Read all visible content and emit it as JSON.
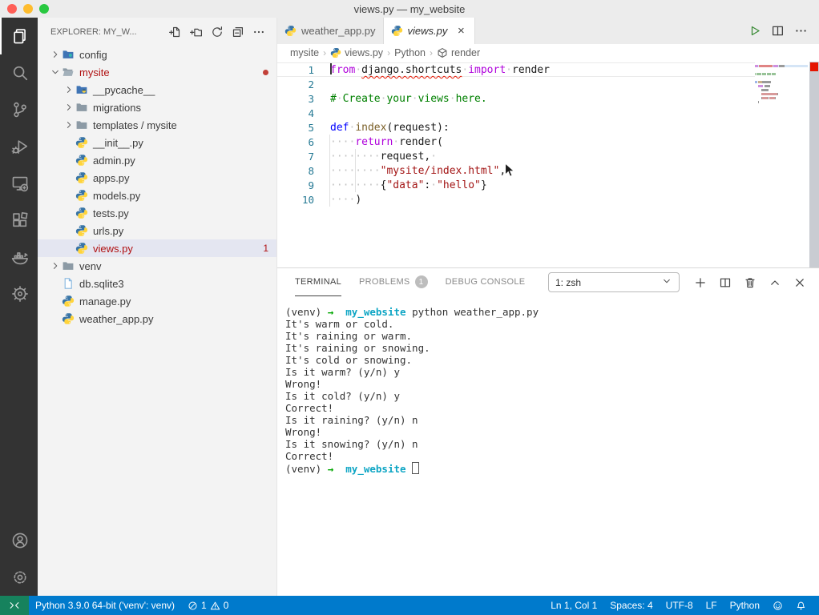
{
  "window": {
    "title": "views.py — my_website"
  },
  "activity_bar": {
    "top": [
      {
        "name": "explorer",
        "icon": "files",
        "active": true
      },
      {
        "name": "search",
        "icon": "search",
        "active": false
      },
      {
        "name": "source-control",
        "icon": "source-control",
        "active": false
      },
      {
        "name": "run-debug",
        "icon": "run-debug",
        "active": false
      },
      {
        "name": "remote-explorer",
        "icon": "remote-explorer",
        "active": false
      },
      {
        "name": "extensions",
        "icon": "extensions",
        "active": false
      },
      {
        "name": "docker",
        "icon": "docker",
        "active": false
      },
      {
        "name": "wheel",
        "icon": "wheel",
        "active": false
      }
    ],
    "bottom": [
      {
        "name": "accounts",
        "icon": "account",
        "active": false
      },
      {
        "name": "settings",
        "icon": "gear",
        "active": false
      }
    ]
  },
  "sidebar": {
    "title": "EXPLORER: MY_W...",
    "actions": [
      {
        "name": "new-file",
        "icon": "new-file"
      },
      {
        "name": "new-folder",
        "icon": "new-folder"
      },
      {
        "name": "refresh-explorer",
        "icon": "refresh"
      },
      {
        "name": "collapse-folders",
        "icon": "collapse-all"
      },
      {
        "name": "views-and-more-actions",
        "icon": "ellipsis"
      }
    ],
    "tree": [
      {
        "label": "config",
        "depth": 0,
        "chevron": "right",
        "icon": "folder-config"
      },
      {
        "label": "mysite",
        "depth": 0,
        "chevron": "down",
        "icon": "folder-open",
        "error": true,
        "dot": true
      },
      {
        "label": "__pycache__",
        "depth": 1,
        "chevron": "right",
        "icon": "folder-pycache"
      },
      {
        "label": "migrations",
        "depth": 1,
        "chevron": "right",
        "icon": "folder"
      },
      {
        "label": "templates / mysite",
        "depth": 1,
        "chevron": "right",
        "icon": "folder"
      },
      {
        "label": "__init__.py",
        "depth": 1,
        "icon": "python"
      },
      {
        "label": "admin.py",
        "depth": 1,
        "icon": "python"
      },
      {
        "label": "apps.py",
        "depth": 1,
        "icon": "python"
      },
      {
        "label": "models.py",
        "depth": 1,
        "icon": "python"
      },
      {
        "label": "tests.py",
        "depth": 1,
        "icon": "python"
      },
      {
        "label": "urls.py",
        "depth": 1,
        "icon": "python"
      },
      {
        "label": "views.py",
        "depth": 1,
        "icon": "python",
        "error": true,
        "selected": true,
        "badge": "1"
      },
      {
        "label": "venv",
        "depth": 0,
        "chevron": "right",
        "icon": "folder"
      },
      {
        "label": "db.sqlite3",
        "depth": 0,
        "icon": "file"
      },
      {
        "label": "manage.py",
        "depth": 0,
        "icon": "python"
      },
      {
        "label": "weather_app.py",
        "depth": 0,
        "icon": "python"
      }
    ]
  },
  "editor": {
    "tabs": [
      {
        "label": "weather_app.py",
        "icon": "python",
        "active": false,
        "italic": false,
        "close": false
      },
      {
        "label": "views.py",
        "icon": "python",
        "active": true,
        "italic": true,
        "close": true
      }
    ],
    "actions": [
      {
        "name": "run-python-file",
        "icon": "play",
        "green": true
      },
      {
        "name": "split-editor",
        "icon": "split",
        "green": false
      },
      {
        "name": "more-actions",
        "icon": "ellipsis",
        "green": false
      }
    ],
    "breadcrumb": [
      {
        "label": "mysite"
      },
      {
        "label": "views.py",
        "icon": "python"
      },
      {
        "label": "Python"
      },
      {
        "label": "render",
        "icon": "symbol-namespace"
      }
    ],
    "code_lines": [
      {
        "n": "1",
        "current": true,
        "caret": true,
        "tokens": [
          [
            "from",
            "kw"
          ],
          [
            "·",
            "ws"
          ],
          [
            "django.shortcuts",
            "err"
          ],
          [
            "·",
            "ws"
          ],
          [
            "import",
            "kw"
          ],
          [
            "·",
            "ws"
          ],
          [
            "render",
            "fg"
          ]
        ]
      },
      {
        "n": "2",
        "tokens": []
      },
      {
        "n": "3",
        "tokens": [
          [
            "#",
            "com"
          ],
          [
            "·",
            "ws"
          ],
          [
            "Create",
            "com"
          ],
          [
            "·",
            "ws"
          ],
          [
            "your",
            "com"
          ],
          [
            "·",
            "ws"
          ],
          [
            "views",
            "com"
          ],
          [
            "·",
            "ws"
          ],
          [
            "here.",
            "com"
          ]
        ]
      },
      {
        "n": "4",
        "tokens": []
      },
      {
        "n": "5",
        "tokens": [
          [
            "def",
            "def"
          ],
          [
            "·",
            "ws"
          ],
          [
            "index",
            "fn"
          ],
          [
            "(request):",
            "fg"
          ]
        ]
      },
      {
        "n": "6",
        "tokens": [
          [
            "····",
            "ws"
          ],
          [
            "return",
            "kw"
          ],
          [
            "·",
            "ws"
          ],
          [
            "render(",
            "fg"
          ]
        ]
      },
      {
        "n": "7",
        "tokens": [
          [
            "········",
            "ws"
          ],
          [
            "request,",
            "fg"
          ],
          [
            "·",
            "ws"
          ]
        ]
      },
      {
        "n": "8",
        "tokens": [
          [
            "········",
            "ws"
          ],
          [
            "\"mysite/index.html\"",
            "str"
          ],
          [
            ",",
            "fg"
          ],
          [
            "·",
            "ws"
          ]
        ]
      },
      {
        "n": "9",
        "tokens": [
          [
            "········",
            "ws"
          ],
          [
            "{",
            "fg"
          ],
          [
            "\"data\"",
            "str"
          ],
          [
            ":",
            "fg"
          ],
          [
            "·",
            "ws"
          ],
          [
            "\"hello\"",
            "str"
          ],
          [
            "}",
            "fg"
          ]
        ]
      },
      {
        "n": "10",
        "tokens": [
          [
            "····",
            "ws"
          ],
          [
            ")",
            "fg"
          ]
        ]
      }
    ]
  },
  "panel": {
    "tabs": [
      {
        "name": "terminal",
        "label": "TERMINAL",
        "active": true
      },
      {
        "name": "problems",
        "label": "PROBLEMS",
        "badge": "1",
        "active": false
      },
      {
        "name": "debug-console",
        "label": "DEBUG CONSOLE",
        "active": false
      }
    ],
    "shell_select": {
      "value": "1: zsh"
    },
    "actions": [
      {
        "name": "new-terminal",
        "icon": "add"
      },
      {
        "name": "split-terminal",
        "icon": "split"
      },
      {
        "name": "kill-terminal",
        "icon": "trash"
      },
      {
        "name": "maximize-panel",
        "icon": "chevron-up"
      },
      {
        "name": "close-panel",
        "icon": "close"
      }
    ],
    "terminal_lines": [
      {
        "tokens": [
          [
            "(venv) ",
            "t"
          ],
          [
            "→",
            "ag"
          ],
          [
            "  ",
            "t"
          ],
          [
            "my_website",
            "ac"
          ],
          [
            " python weather_app.py",
            "t"
          ]
        ],
        "cursor": false
      },
      {
        "tokens": [
          [
            "It's warm or cold.",
            "t"
          ]
        ],
        "cursor": false
      },
      {
        "tokens": [
          [
            "It's raining or warm.",
            "t"
          ]
        ],
        "cursor": false
      },
      {
        "tokens": [
          [
            "It's raining or snowing.",
            "t"
          ]
        ],
        "cursor": false
      },
      {
        "tokens": [
          [
            "It's cold or snowing.",
            "t"
          ]
        ],
        "cursor": false
      },
      {
        "tokens": [
          [
            "Is it warm? (y/n) y",
            "t"
          ]
        ],
        "cursor": false
      },
      {
        "tokens": [
          [
            "Wrong!",
            "t"
          ]
        ],
        "cursor": false
      },
      {
        "tokens": [
          [
            "Is it cold? (y/n) y",
            "t"
          ]
        ],
        "cursor": false
      },
      {
        "tokens": [
          [
            "Correct!",
            "t"
          ]
        ],
        "cursor": false
      },
      {
        "tokens": [
          [
            "Is it raining? (y/n) n",
            "t"
          ]
        ],
        "cursor": false
      },
      {
        "tokens": [
          [
            "Wrong!",
            "t"
          ]
        ],
        "cursor": false
      },
      {
        "tokens": [
          [
            "Is it snowing? (y/n) n",
            "t"
          ]
        ],
        "cursor": false
      },
      {
        "tokens": [
          [
            "Correct!",
            "t"
          ]
        ],
        "cursor": false
      },
      {
        "tokens": [
          [
            "(venv) ",
            "t"
          ],
          [
            "→",
            "ag"
          ],
          [
            "  ",
            "t"
          ],
          [
            "my_website",
            "ac"
          ],
          [
            " ",
            "t"
          ]
        ],
        "cursor": true
      }
    ]
  },
  "status_bar": {
    "left": [
      {
        "name": "python-interpreter",
        "label": "Python 3.9.0 64-bit ('venv': venv)"
      },
      {
        "name": "problems-summary",
        "parts": [
          {
            "icon": "error",
            "label": "1"
          },
          {
            "icon": "warning",
            "label": "0"
          }
        ]
      }
    ],
    "right": [
      {
        "name": "cursor-position",
        "label": "Ln 1, Col 1"
      },
      {
        "name": "indentation",
        "label": "Spaces: 4"
      },
      {
        "name": "encoding",
        "label": "UTF-8"
      },
      {
        "name": "eol-sequence",
        "label": "LF"
      },
      {
        "name": "language-mode",
        "label": "Python"
      },
      {
        "name": "feedback",
        "icon": "feedback"
      },
      {
        "name": "notifications",
        "icon": "bell"
      }
    ]
  },
  "colors": {
    "status_bar": "#007acc",
    "remote_box": "#16825d",
    "error_red": "#b01011",
    "accent_run": "#388a34",
    "traffic": [
      "#ff5f57",
      "#febc2e",
      "#28c840"
    ]
  }
}
